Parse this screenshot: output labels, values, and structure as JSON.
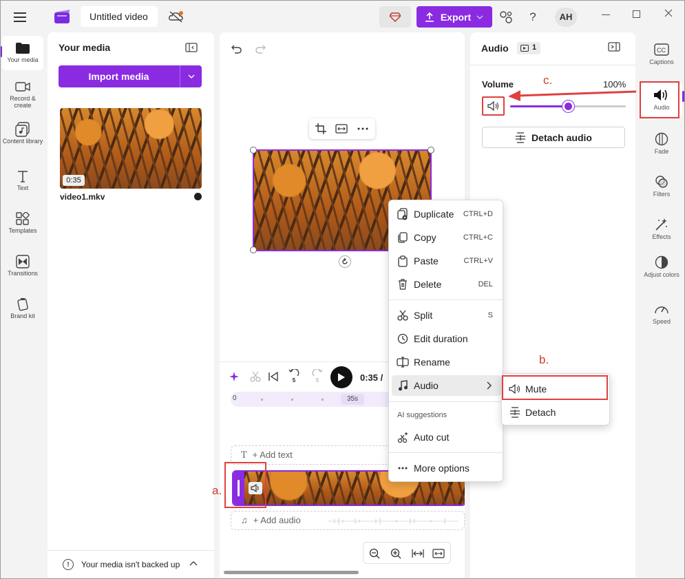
{
  "titlebar": {
    "project_title": "Untitled video",
    "export_label": "Export",
    "avatar_initials": "AH"
  },
  "left_nav": [
    {
      "label": "Your media",
      "icon": "folder-icon"
    },
    {
      "label": "Record & create",
      "icon": "camera-icon"
    },
    {
      "label": "Content library",
      "icon": "library-icon"
    },
    {
      "label": "Text",
      "icon": "text-icon"
    },
    {
      "label": "Templates",
      "icon": "templates-icon"
    },
    {
      "label": "Transitions",
      "icon": "transitions-icon"
    },
    {
      "label": "Brand kit",
      "icon": "brand-kit-icon"
    }
  ],
  "media_panel": {
    "title": "Your media",
    "import_label": "Import media",
    "item": {
      "name": "video1.mkv",
      "duration": "0:35"
    },
    "backup_text": "Your media isn't backed up"
  },
  "timeline": {
    "time_display": "0:35 /",
    "ruler_start": "0",
    "ruler_marker": "35s",
    "add_text_label": "+ Add text",
    "add_audio_label": "+ Add audio",
    "skip_seconds": "5"
  },
  "context_menu": {
    "items": [
      {
        "label": "Duplicate",
        "shortcut": "CTRL+D"
      },
      {
        "label": "Copy",
        "shortcut": "CTRL+C"
      },
      {
        "label": "Paste",
        "shortcut": "CTRL+V"
      },
      {
        "label": "Delete",
        "shortcut": "DEL"
      },
      {
        "label": "Split",
        "shortcut": "S"
      },
      {
        "label": "Edit duration",
        "shortcut": ""
      },
      {
        "label": "Rename",
        "shortcut": ""
      },
      {
        "label": "Audio",
        "shortcut": ""
      }
    ],
    "section_label": "AI suggestions",
    "auto_cut": "Auto cut",
    "more_options": "More options"
  },
  "audio_submenu": {
    "mute": "Mute",
    "detach": "Detach"
  },
  "audio_panel": {
    "title": "Audio",
    "badge_count": "1",
    "volume_label": "Volume",
    "volume_value": "100%",
    "volume_fraction": 0.5,
    "detach_label": "Detach audio"
  },
  "right_rail": [
    {
      "label": "Captions",
      "icon": "captions-icon"
    },
    {
      "label": "Audio",
      "icon": "speaker-icon"
    },
    {
      "label": "Fade",
      "icon": "fade-icon"
    },
    {
      "label": "Filters",
      "icon": "filters-icon"
    },
    {
      "label": "Effects",
      "icon": "effects-icon"
    },
    {
      "label": "Adjust colors",
      "icon": "adjust-colors-icon"
    },
    {
      "label": "Speed",
      "icon": "speed-icon"
    }
  ],
  "annotations": {
    "a": "a.",
    "b": "b.",
    "c": "c."
  },
  "colors": {
    "accent": "#8a2be2",
    "annotation": "#e04040"
  }
}
